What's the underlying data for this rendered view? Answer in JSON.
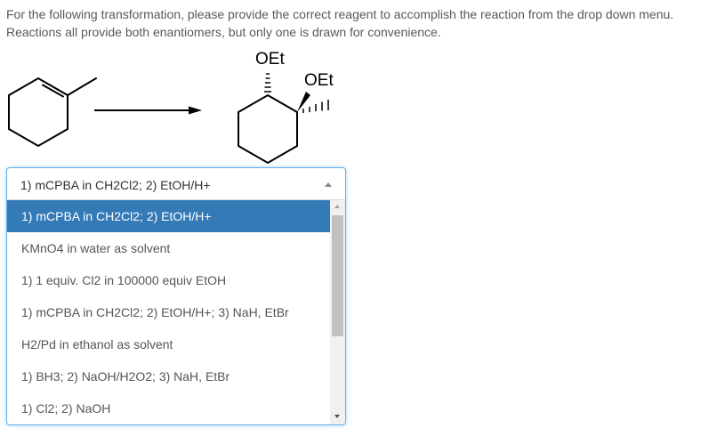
{
  "question": {
    "line1": "For the following transformation, please provide the correct reagent to accomplish the reaction from the drop down menu.",
    "line2": "Reactions all provide both enantiomers, but only one is drawn for convenience."
  },
  "reaction": {
    "product_label_top": "OEt",
    "product_label_right": "OEt"
  },
  "dropdown": {
    "selected": "1) mCPBA in CH2Cl2; 2) EtOH/H+",
    "options": [
      "1) mCPBA in CH2Cl2; 2) EtOH/H+",
      "KMnO4 in water as solvent",
      "1) 1 equiv. Cl2 in 100000 equiv EtOH",
      "1) mCPBA in CH2Cl2; 2) EtOH/H+; 3) NaH, EtBr",
      "H2/Pd in ethanol as solvent",
      "1) BH3; 2) NaOH/H2O2; 3) NaH, EtBr",
      "1) Cl2; 2) NaOH"
    ],
    "highlighted_index": 0,
    "highlight_color": "#337ab7",
    "focus_border_color": "#66afe9"
  }
}
